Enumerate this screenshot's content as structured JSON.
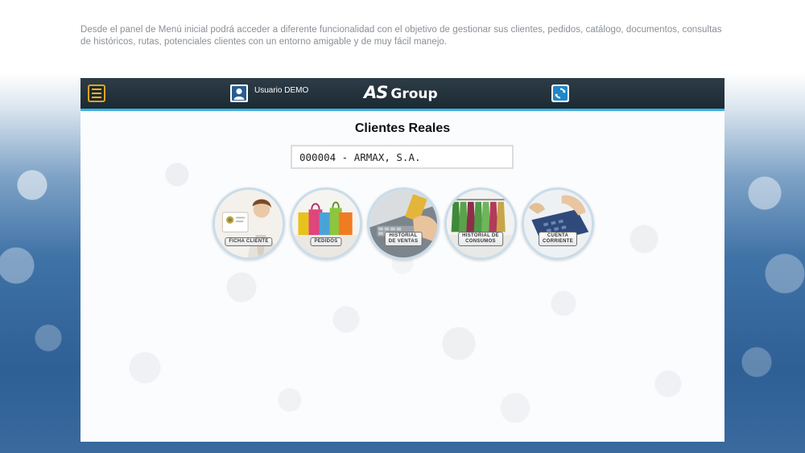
{
  "intro_text": "Desde el panel de Menú inicial podrá acceder a diferente funcionalidad con el objetivo de gestionar sus clientes, pedidos, catálogo, documentos, consultas de históricos, rutas, potenciales clientes con un entorno amigable y de muy fácil manejo.",
  "header": {
    "menu_icon": "hamburger-menu-icon",
    "user_icon": "user-icon",
    "user_label": "Usuario DEMO",
    "logo_as": "AS",
    "logo_group": "Group",
    "refresh_icon": "refresh-icon",
    "accent_color": "#3fb0df",
    "menu_color": "#f0b323"
  },
  "main": {
    "title": "Clientes Reales",
    "client_value": "000004 - ARMAX, S.A."
  },
  "actions": [
    {
      "label": "FICHA CLIENTE",
      "icon": "client-card-icon"
    },
    {
      "label": "PEDIDOS",
      "icon": "shopping-bags-icon"
    },
    {
      "label": "HISTORIAL\nDE VENTAS",
      "icon": "card-payment-icon"
    },
    {
      "label": "HISTORIAL DE\nCONSUMOS",
      "icon": "clothing-rack-icon"
    },
    {
      "label": "CUENTA\nCORRIENTE",
      "icon": "calculator-icon"
    }
  ]
}
